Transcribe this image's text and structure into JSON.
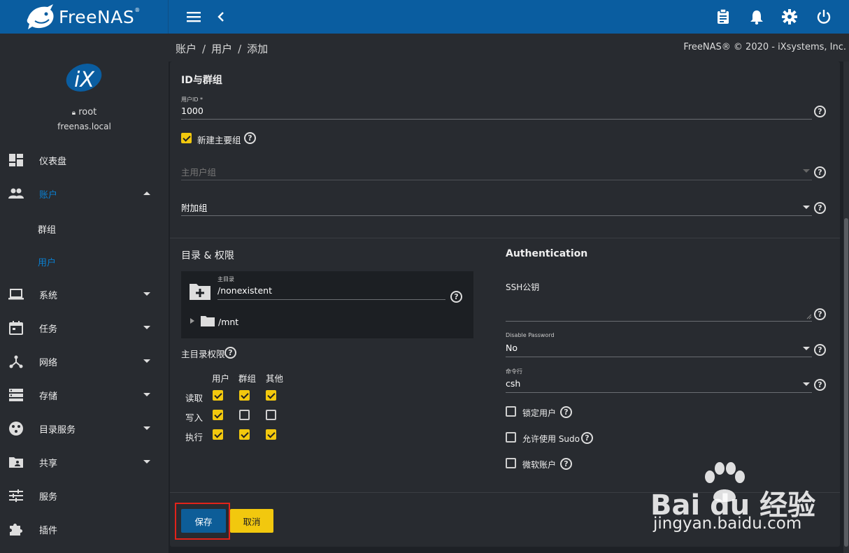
{
  "app": {
    "logo_text": "FreeNAS",
    "logo_reg": "®"
  },
  "colors": {
    "topbar": "#0a5da0",
    "accent_yellow": "#f2c80e",
    "save_blue": "#0d5d98",
    "active_blue": "#0a7fd0"
  },
  "topbar": {
    "menu_icon": "hamburger-icon",
    "back_icon": "chevron-left-icon",
    "right_icons": [
      "clipboard-icon",
      "bell-icon",
      "gear-icon",
      "power-icon"
    ]
  },
  "sidebar": {
    "user": "root",
    "host": "freenas.local",
    "items": [
      {
        "label": "仪表盘",
        "icon": "dashboard-icon"
      },
      {
        "label": "账户",
        "icon": "people-icon",
        "active": true,
        "expanded": true
      },
      {
        "label": "群组",
        "sub": true
      },
      {
        "label": "用户",
        "sub": true,
        "active": true
      },
      {
        "label": "系统",
        "icon": "laptop-icon"
      },
      {
        "label": "任务",
        "icon": "calendar-icon"
      },
      {
        "label": "网络",
        "icon": "network-icon"
      },
      {
        "label": "存储",
        "icon": "storage-icon"
      },
      {
        "label": "目录服务",
        "icon": "directory-icon"
      },
      {
        "label": "共享",
        "icon": "share-folder-icon"
      },
      {
        "label": "服务",
        "icon": "sliders-icon"
      },
      {
        "label": "插件",
        "icon": "puzzle-icon"
      }
    ]
  },
  "breadcrumb": {
    "items": [
      "账户",
      "用户",
      "添加"
    ],
    "sep": "/"
  },
  "copyright": "FreeNAS® © 2020 - iXsystems, Inc.",
  "form": {
    "id_section": {
      "title": "ID与群组",
      "uid_label": "用户ID *",
      "uid_value": "1000",
      "new_group_label": "新建主要组",
      "new_group_checked": true,
      "primary_group_placeholder": "主用户组",
      "aux_group_placeholder": "附加组"
    },
    "dir_section": {
      "title": "目录 & 权限",
      "home_label": "主目录",
      "home_value": "/nonexistent",
      "tree_item": "/mnt",
      "perm_title": "主目录权限",
      "perm_cols": [
        "用户",
        "群组",
        "其他"
      ],
      "perm_rows": [
        {
          "label": "读取",
          "vals": [
            true,
            true,
            true
          ]
        },
        {
          "label": "写入",
          "vals": [
            true,
            false,
            false
          ]
        },
        {
          "label": "执行",
          "vals": [
            true,
            true,
            true
          ]
        }
      ]
    },
    "auth_section": {
      "title": "Authentication",
      "ssh_label": "SSH公钥",
      "disable_pw_label": "Disable Password",
      "disable_pw_value": "No",
      "shell_label": "命令行",
      "shell_value": "csh",
      "lock_user": "锁定用户",
      "allow_sudo": "允许使用 Sudo",
      "ms_account": "微软账户"
    },
    "buttons": {
      "save": "保存",
      "cancel": "取消"
    }
  },
  "watermark": {
    "brand": "Bai du 经验",
    "url": "jingyan.baidu.com"
  }
}
